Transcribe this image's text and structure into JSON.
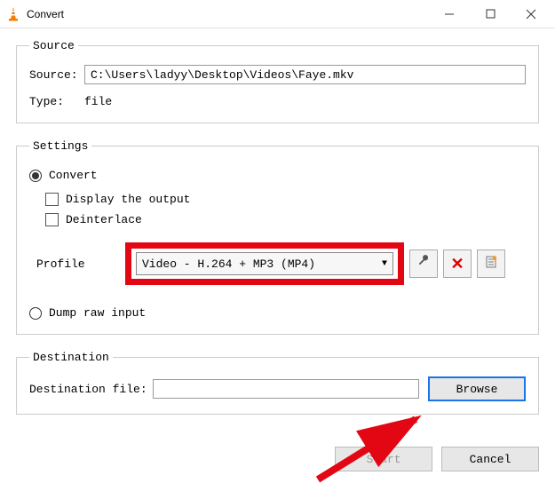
{
  "title": "Convert",
  "sections": {
    "source": {
      "legend": "Source",
      "source_label": "Source:",
      "source_value": "C:\\Users\\ladyy\\Desktop\\Videos\\Faye.mkv",
      "type_label": "Type:",
      "type_value": "file"
    },
    "settings": {
      "legend": "Settings",
      "convert_label": "Convert",
      "display_output_label": "Display the output",
      "deinterlace_label": "Deinterlace",
      "profile_label": "Profile",
      "profile_value": "Video - H.264 + MP3 (MP4)",
      "dump_raw_label": "Dump raw input"
    },
    "destination": {
      "legend": "Destination",
      "dest_label": "Destination file:",
      "dest_value": "",
      "browse_label": "Browse"
    }
  },
  "buttons": {
    "start": "Start",
    "cancel": "Cancel"
  }
}
